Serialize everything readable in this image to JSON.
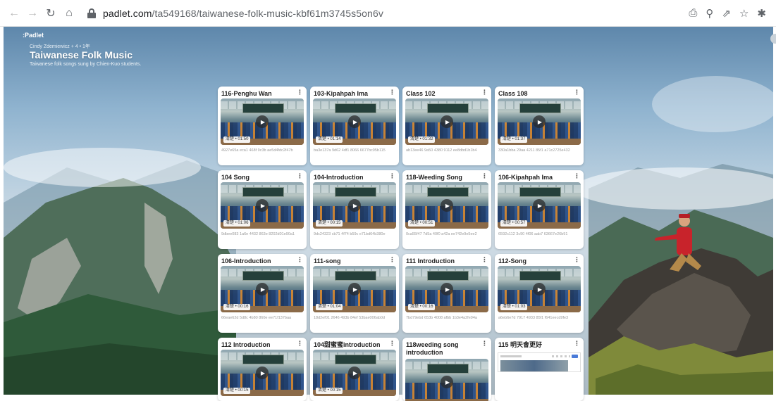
{
  "browser": {
    "url_host": "padlet.com",
    "url_path": "/ta549168/taiwanese-folk-music-kbf61m3745s5on6v",
    "icons": [
      "back-icon",
      "forward-icon",
      "reload-icon",
      "home-icon",
      "lock-icon",
      "install-app-icon",
      "zoom-icon",
      "share-icon",
      "star-icon",
      "extensions-icon"
    ]
  },
  "board": {
    "logo": ":Padlet",
    "author": "Cindy Zdemiewicz + 4 • 1年",
    "title": "Taiwanese Folk Music",
    "description": "Taiwanese folk songs sung by Chien-Kuo students."
  },
  "cards": [
    {
      "title": "116-Penghu Wan",
      "duration": "清楚 • 01:50",
      "meta": "4927e65a eca1 468f 9c3b ae5d4fdc2f47b",
      "kind": "video"
    },
    {
      "title": "103-Kipahpah Ima",
      "duration": "清楚 • 01:14",
      "meta": "ba3e137a 9d62 4df1 8066 6677bc95b115",
      "kind": "video"
    },
    {
      "title": "Class 102",
      "duration": "清楚 • 01:32",
      "meta": "ab13ee46 9a50 4380 9112 ee8dbd1b1b4",
      "kind": "video"
    },
    {
      "title": "Class 108",
      "duration": "清楚 • 01:37",
      "meta": "330a1bba 29aa 4211 85f1 a71c2725e432",
      "kind": "video"
    },
    {
      "title": "104 Song",
      "duration": "清楚 • 01:06",
      "meta": "9dbee083 1a6e 4432 863e 8202d01e90a1",
      "kind": "video"
    },
    {
      "title": "104-Introduction",
      "duration": "清楚 • 00:15",
      "meta": "9dc24323 cb71 4f74 b59c e71bd64b380e",
      "kind": "video"
    },
    {
      "title": "118-Weeding Song",
      "duration": "清楚 • 00:51",
      "meta": "0ca55f47 7d5a 40f0 a42a ee742e9e5ee2",
      "kind": "video"
    },
    {
      "title": "106-Kipahpah Ima",
      "duration": "清楚 • 00:57",
      "meta": "6592c112 3c90 4f06 aab7 63667e26b91",
      "kind": "video"
    },
    {
      "title": "106-Introduction",
      "duration": "清楚 • 00:16",
      "meta": "66eae62d 5d8c 4b80 860e ee71f137baa",
      "kind": "video"
    },
    {
      "title": "111-song",
      "duration": "清楚 • 01:04",
      "meta": "18d2ef01 2646 493b 84ef 53bae006ab0d",
      "kind": "video"
    },
    {
      "title": "111 Introduction",
      "duration": "清楚 • 00:16",
      "meta": "7bd79ebd 653b 4008 afbb 1b3e4a2fe94a",
      "kind": "video"
    },
    {
      "title": "112-Song",
      "duration": "清楚 • 01:03",
      "meta": "a6eb6e7d 7917 4933 85f1 f641eecd9fe3",
      "kind": "video"
    },
    {
      "title": "112 Introduction",
      "duration": "清楚 • 00:15",
      "meta": "",
      "kind": "video"
    },
    {
      "title": "104甜蜜蜜introduction",
      "duration": "清楚 • 00:15",
      "meta": "",
      "kind": "video"
    },
    {
      "title": "118weeding song introduction",
      "duration": "",
      "meta": "",
      "kind": "video"
    },
    {
      "title": "115 明天會更好",
      "duration": "",
      "meta": "",
      "kind": "screenshot"
    }
  ]
}
